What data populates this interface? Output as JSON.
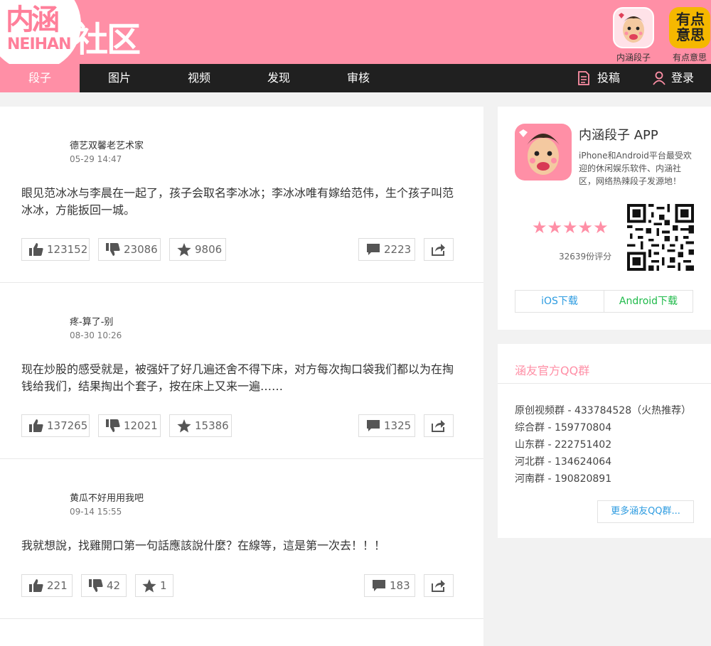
{
  "brand": {
    "logo_big": "内涵",
    "logo_latin": "NEIHAN",
    "logo_suffix": "社区",
    "colors": {
      "pink": "#ff8fa6",
      "nav_bg": "#202020",
      "ios_blue": "#2c9be0",
      "android_green": "#1fba4a"
    }
  },
  "apps": [
    {
      "label": "内涵段子",
      "icon": "neihan-app-icon"
    },
    {
      "label": "有点意思",
      "icon_text": "有点意思",
      "icon": "youdian-app-icon"
    }
  ],
  "nav": {
    "items": [
      "段子",
      "图片",
      "视频",
      "发现",
      "审核"
    ],
    "active_index": 0,
    "submit_label": "投稿",
    "login_label": "登录"
  },
  "posts": [
    {
      "author": "德艺双馨老艺术家",
      "time": "05-29 14:47",
      "text": "眼见范冰冰与李晨在一起了，孩子会取名李冰冰；李冰冰唯有嫁给范伟，生个孩子叫范冰冰，方能扳回一城。",
      "likes": "123152",
      "dislikes": "23086",
      "favorites": "9806",
      "comments": "2223"
    },
    {
      "author": "疼-算了-别",
      "time": "08-30 10:26",
      "text": "现在炒股的感受就是，被强奸了好几遍还舍不得下床，对方每次掏口袋我们都以为在掏钱给我们，结果掏出个套子，按在床上又来一遍……",
      "likes": "137265",
      "dislikes": "12021",
      "favorites": "15386",
      "comments": "1325"
    },
    {
      "author": "黄瓜不好用用我吧",
      "time": "09-14 15:55",
      "text": "我就想說，找雞開口第一句話應該說什麼？在線等，這是第一次去！！！",
      "likes": "221",
      "dislikes": "42",
      "favorites": "1",
      "comments": "183"
    }
  ],
  "sidebar": {
    "app": {
      "title": "内涵段子 APP",
      "desc": "iPhone和Android平台最受欢迎的休闲娱乐软件、内涵社区，网络热辣段子发源地！",
      "stars": "★★★★★",
      "rating_score": 5,
      "rating_count": "32639份评分",
      "ios_label": "iOS下载",
      "android_label": "Android下载"
    },
    "qq": {
      "title": "涵友官方QQ群",
      "groups": [
        "原创视频群 - 433784528（火热推荐）",
        "综合群 - 159770804",
        "山东群 - 222751402",
        "河北群 - 134624064",
        "河南群 - 190820891"
      ],
      "more_label": "更多涵友QQ群..."
    }
  }
}
